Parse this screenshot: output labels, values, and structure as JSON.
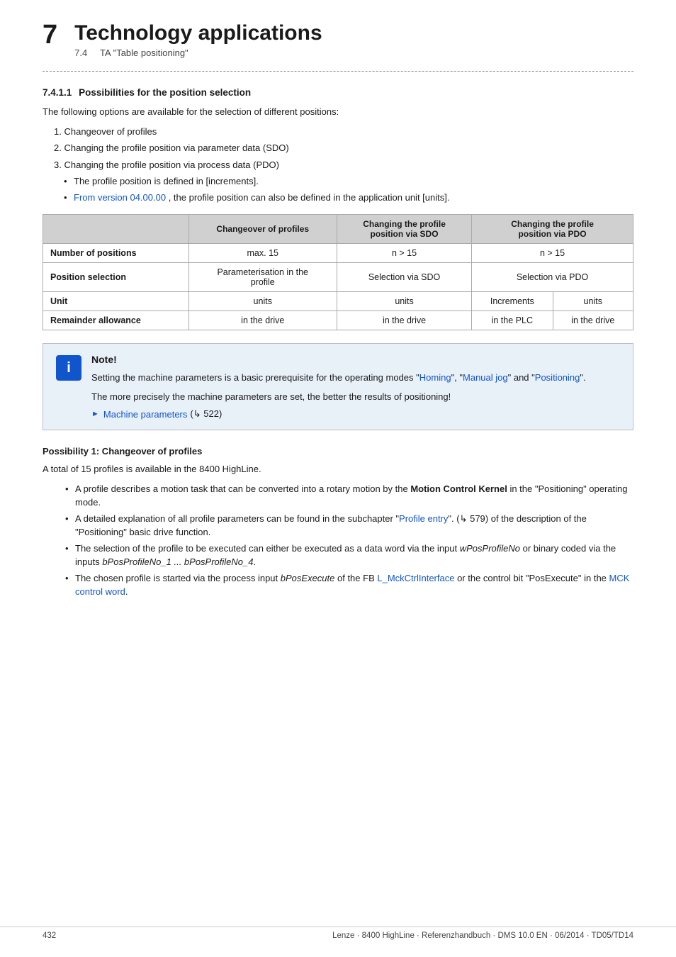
{
  "header": {
    "chapter_number": "7",
    "chapter_title": "Technology applications",
    "chapter_sub": "7.4",
    "chapter_subtitle": "TA \"Table positioning\""
  },
  "section": {
    "number": "7.4.1.1",
    "title": "Possibilities for the position selection"
  },
  "intro_text": "The following options are available for the selection of different positions:",
  "ordered_items": [
    "Changeover of profiles",
    "Changing the profile position via parameter data (SDO)",
    "Changing the profile position via process data (PDO)"
  ],
  "sub_bullets": [
    "The profile position is defined in [increments].",
    "From version 04.00.00 , the profile position can also be defined in the application unit [units]."
  ],
  "sub_bullet_links": {
    "version_link": "From version 04.00.00"
  },
  "table": {
    "headers": [
      "",
      "Changeover of profiles",
      "Changing the profile position via SDO",
      "Changing the profile position via PDO"
    ],
    "rows": [
      {
        "label": "Number of positions",
        "cols": [
          "max. 15",
          "n > 15",
          "n > 15"
        ]
      },
      {
        "label": "Position selection",
        "cols": [
          "Parameterisation in the profile",
          "Selection via SDO",
          "Selection via PDO"
        ]
      },
      {
        "label": "Unit",
        "cols_split": [
          "units",
          "units",
          "Increments",
          "units"
        ]
      },
      {
        "label": "Remainder allowance",
        "cols_split": [
          "in the drive",
          "in the drive",
          "in the PLC",
          "in the drive"
        ]
      }
    ]
  },
  "note": {
    "title": "Note!",
    "icon": "i",
    "body1": "Setting the machine parameters is a basic prerequisite for the operating modes \"Homing\", \"Manual jog\" and \"Positioning\".",
    "body2": "The more precisely the machine parameters are set, the better the results of positioning!",
    "link_text": "Machine parameters",
    "link_ref": "(↳ 522)",
    "links": {
      "homing": "Homing",
      "manual_jog": "Manual jog",
      "positioning": "Positioning"
    }
  },
  "possibility1": {
    "heading": "Possibility 1: Changeover of profiles",
    "intro": "A total of 15 profiles is available in the 8400 HighLine.",
    "bullets": [
      {
        "text": "A profile describes a motion task that can be converted into a rotary motion by the Motion Control Kernel in the \"Positioning\" operating mode.",
        "bold_parts": [
          "Motion Control Kernel"
        ]
      },
      {
        "text": "A detailed explanation of all profile parameters can be found in the subchapter \"Profile entry\". (↳ 579) of the description of the \"Positioning\" basic drive function.",
        "link": "Profile entry"
      },
      {
        "text": "The selection of the profile to be executed can either be executed as a data word via the input wPosProfileNo or binary coded via the inputs bPosProfileNo_1 ... bPosProfileNo_4.",
        "italic_parts": [
          "wPosProfileNo",
          "bPosProfileNo_1 ... bPosProfileNo_4"
        ]
      },
      {
        "text": "The chosen profile is started via the process input bPosExecute of the FB L_MckCtrlInterface or the control bit \"PosExecute\" in the MCK control word.",
        "italic_parts": [
          "bPosExecute"
        ],
        "links": [
          "L_MckCtrlInterface",
          "MCK control word"
        ]
      }
    ]
  },
  "footer": {
    "page_number": "432",
    "doc_info": "Lenze · 8400 HighLine · Referenzhandbuch · DMS 10.0 EN · 06/2014 · TD05/TD14"
  }
}
